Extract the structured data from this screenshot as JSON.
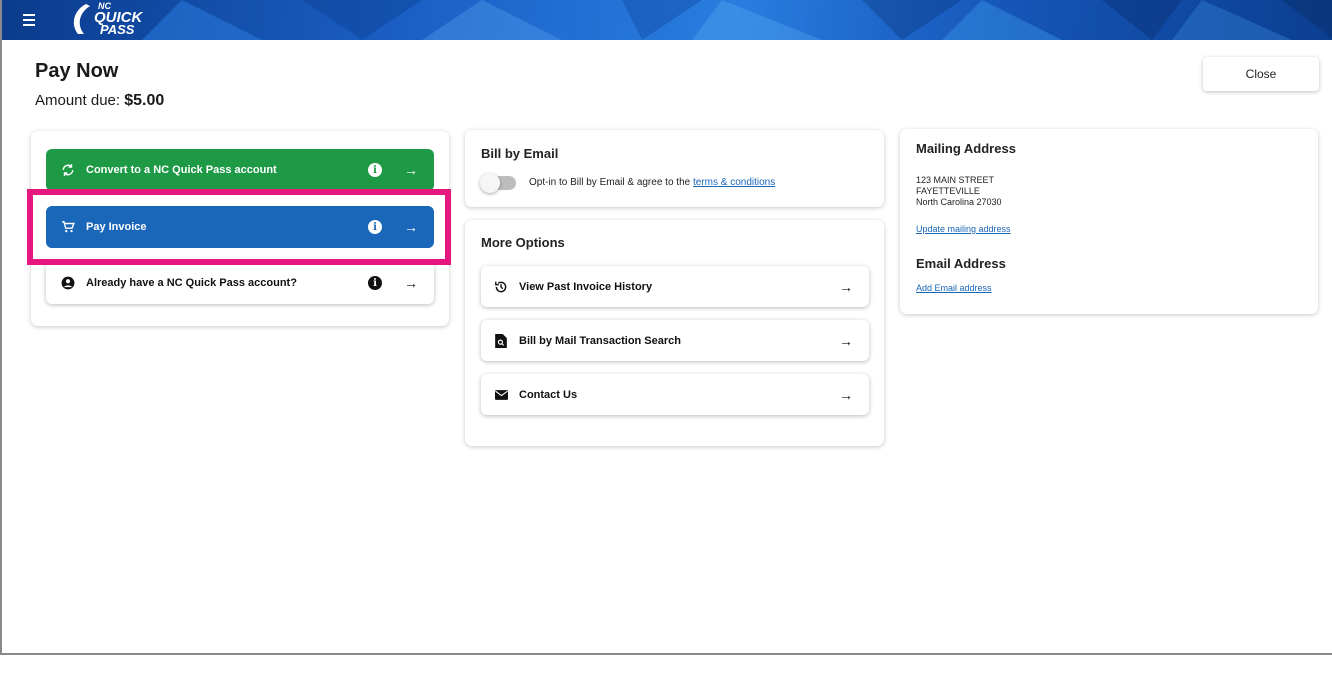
{
  "header": {
    "menu_icon": "hamburger-menu-icon",
    "logo_top": "NC",
    "logo_mid": "QUICK",
    "logo_bot": "PASS",
    "brand_color": "#1a5fc4"
  },
  "page": {
    "title": "Pay Now",
    "amount_label": "Amount due:",
    "amount_value": "$5.00",
    "close_label": "Close"
  },
  "options": [
    {
      "label": "Convert to a NC Quick Pass account",
      "icon": "refresh-icon",
      "color": "#1e9a47"
    },
    {
      "label": "Pay Invoice",
      "icon": "shopping-cart-icon",
      "color": "#1a66b8"
    },
    {
      "label": "Already have a NC Quick Pass account?",
      "icon": "account-circle-icon",
      "color": "#ffffff"
    }
  ],
  "highlight_color": "#e6177f",
  "bill_by_email": {
    "title": "Bill by Email",
    "toggle_on": false,
    "optin_text": "Opt-in to Bill by Email & agree to the",
    "terms_link": "terms & conditions"
  },
  "more_options": {
    "title": "More Options",
    "items": [
      {
        "label": "View Past Invoice History",
        "icon": "history-icon"
      },
      {
        "label": "Bill by Mail Transaction Search",
        "icon": "document-search-icon"
      },
      {
        "label": "Contact Us",
        "icon": "envelope-icon"
      }
    ]
  },
  "mailing": {
    "title": "Mailing Address",
    "line1": "123 MAIN STREET",
    "line2": "FAYETTEVILLE",
    "line3": "North Carolina 27030",
    "update_link": "Update mailing address"
  },
  "email": {
    "title": "Email Address",
    "add_link": "Add Email address"
  }
}
